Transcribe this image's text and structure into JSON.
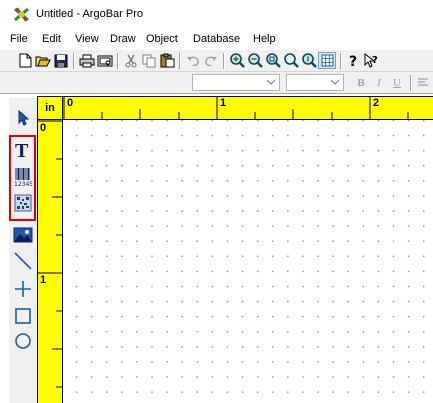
{
  "window": {
    "title": "Untitled - ArgoBar Pro"
  },
  "menu": [
    "File",
    "Edit",
    "View",
    "Draw",
    "Object",
    "Database",
    "Help"
  ],
  "toolbar_buttons": [
    "new-icon",
    "open-icon",
    "save-icon",
    "print-icon",
    "print-preview-icon",
    "cut-icon",
    "copy-icon",
    "paste-icon",
    "undo-icon",
    "redo-icon",
    "zoom-in-icon",
    "zoom-out-icon",
    "zoom-fit-icon",
    "zoom-page-icon",
    "zoom-actual-icon",
    "grid-icon",
    "help-icon",
    "context-help-icon"
  ],
  "format_bar": {
    "font_name": "",
    "font_size": "",
    "buttons": [
      "B",
      "I",
      "U"
    ]
  },
  "toolbox": [
    "pointer-tool",
    "text-tool",
    "barcode-tool",
    "2d-barcode-tool",
    "image-tool",
    "line-tool",
    "crosshair-tool",
    "rectangle-tool",
    "ellipse-tool"
  ],
  "ruler": {
    "unit": "in",
    "h_labels": [
      "0",
      "1",
      "2"
    ],
    "v_labels": [
      "0",
      "1"
    ]
  },
  "colors": {
    "ruler": "#ffff00",
    "highlight": "#e00000",
    "accent": "#1e5aa8"
  }
}
